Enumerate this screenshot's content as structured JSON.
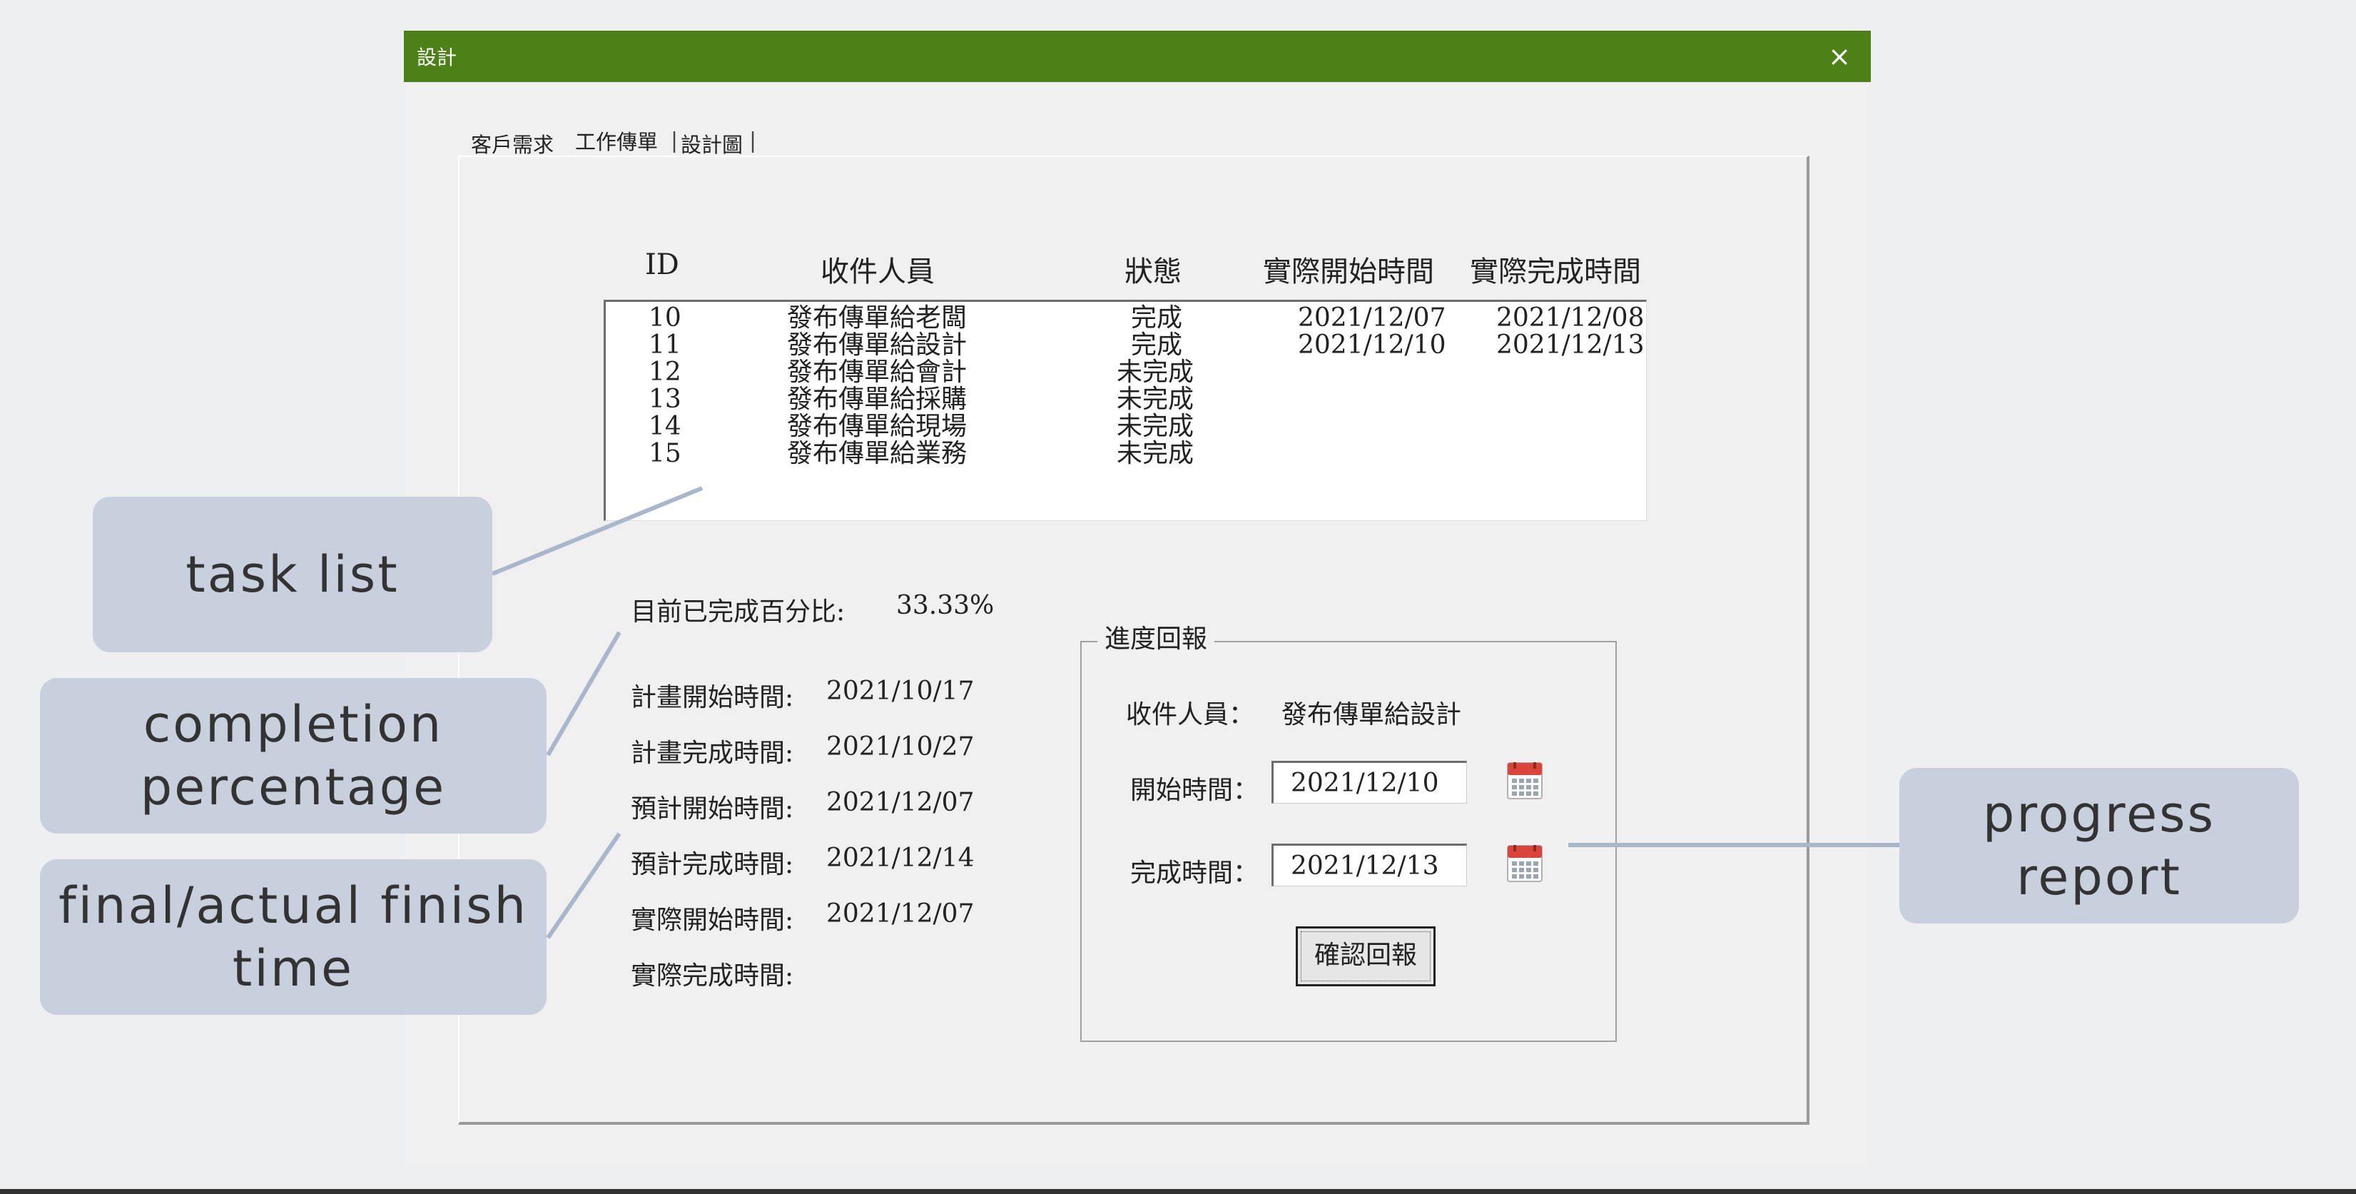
{
  "window": {
    "title": "設計",
    "close_glyph": "×"
  },
  "tabs": [
    {
      "label": "客戶需求"
    },
    {
      "label": "工作傳單"
    },
    {
      "label": "設計圖"
    }
  ],
  "task_table": {
    "columns": [
      "ID",
      "收件人員",
      "狀態",
      "實際開始時間",
      "實際完成時間"
    ],
    "rows": [
      {
        "id": "10",
        "recipient": "發布傳單給老闆",
        "status": "完成",
        "start": "2021/12/07",
        "finish": "2021/12/08"
      },
      {
        "id": "11",
        "recipient": "發布傳單給設計",
        "status": "完成",
        "start": "2021/12/10",
        "finish": "2021/12/13"
      },
      {
        "id": "12",
        "recipient": "發布傳單給會計",
        "status": "未完成",
        "start": "",
        "finish": ""
      },
      {
        "id": "13",
        "recipient": "發布傳單給採購",
        "status": "未完成",
        "start": "",
        "finish": ""
      },
      {
        "id": "14",
        "recipient": "發布傳單給現場",
        "status": "未完成",
        "start": "",
        "finish": ""
      },
      {
        "id": "15",
        "recipient": "發布傳單給業務",
        "status": "未完成",
        "start": "",
        "finish": ""
      }
    ]
  },
  "summary": {
    "completion_label": "目前已完成百分比:",
    "completion_value": "33.33%",
    "plan_start_label": "計畫開始時間:",
    "plan_start_value": "2021/10/17",
    "plan_finish_label": "計畫完成時間:",
    "plan_finish_value": "2021/10/27",
    "est_start_label": "預計開始時間:",
    "est_start_value": "2021/12/07",
    "est_finish_label": "預計完成時間:",
    "est_finish_value": "2021/12/14",
    "actual_start_label": "實際開始時間:",
    "actual_start_value": "2021/12/07",
    "actual_finish_label": "實際完成時間:",
    "actual_finish_value": ""
  },
  "progress_report": {
    "title": "進度回報",
    "recipient_label": "收件人員：",
    "recipient_value": "發布傳單給設計",
    "start_label": "開始時間：",
    "start_value": "2021/12/10",
    "finish_label": "完成時間：",
    "finish_value": "2021/12/13",
    "confirm_label": "確認回報",
    "calendar_icon": "calendar-icon"
  },
  "callouts": {
    "task_list": "task list",
    "completion_line1": "completion",
    "completion_line2": "percentage",
    "finish_line1": "final/actual finish",
    "finish_line2": "time",
    "progress_line1": "progress",
    "progress_line2": "report"
  },
  "colors": {
    "titlebar": "#4b8117",
    "callout_bg": "#c8d0de",
    "leader_line": "#aab6cc"
  }
}
